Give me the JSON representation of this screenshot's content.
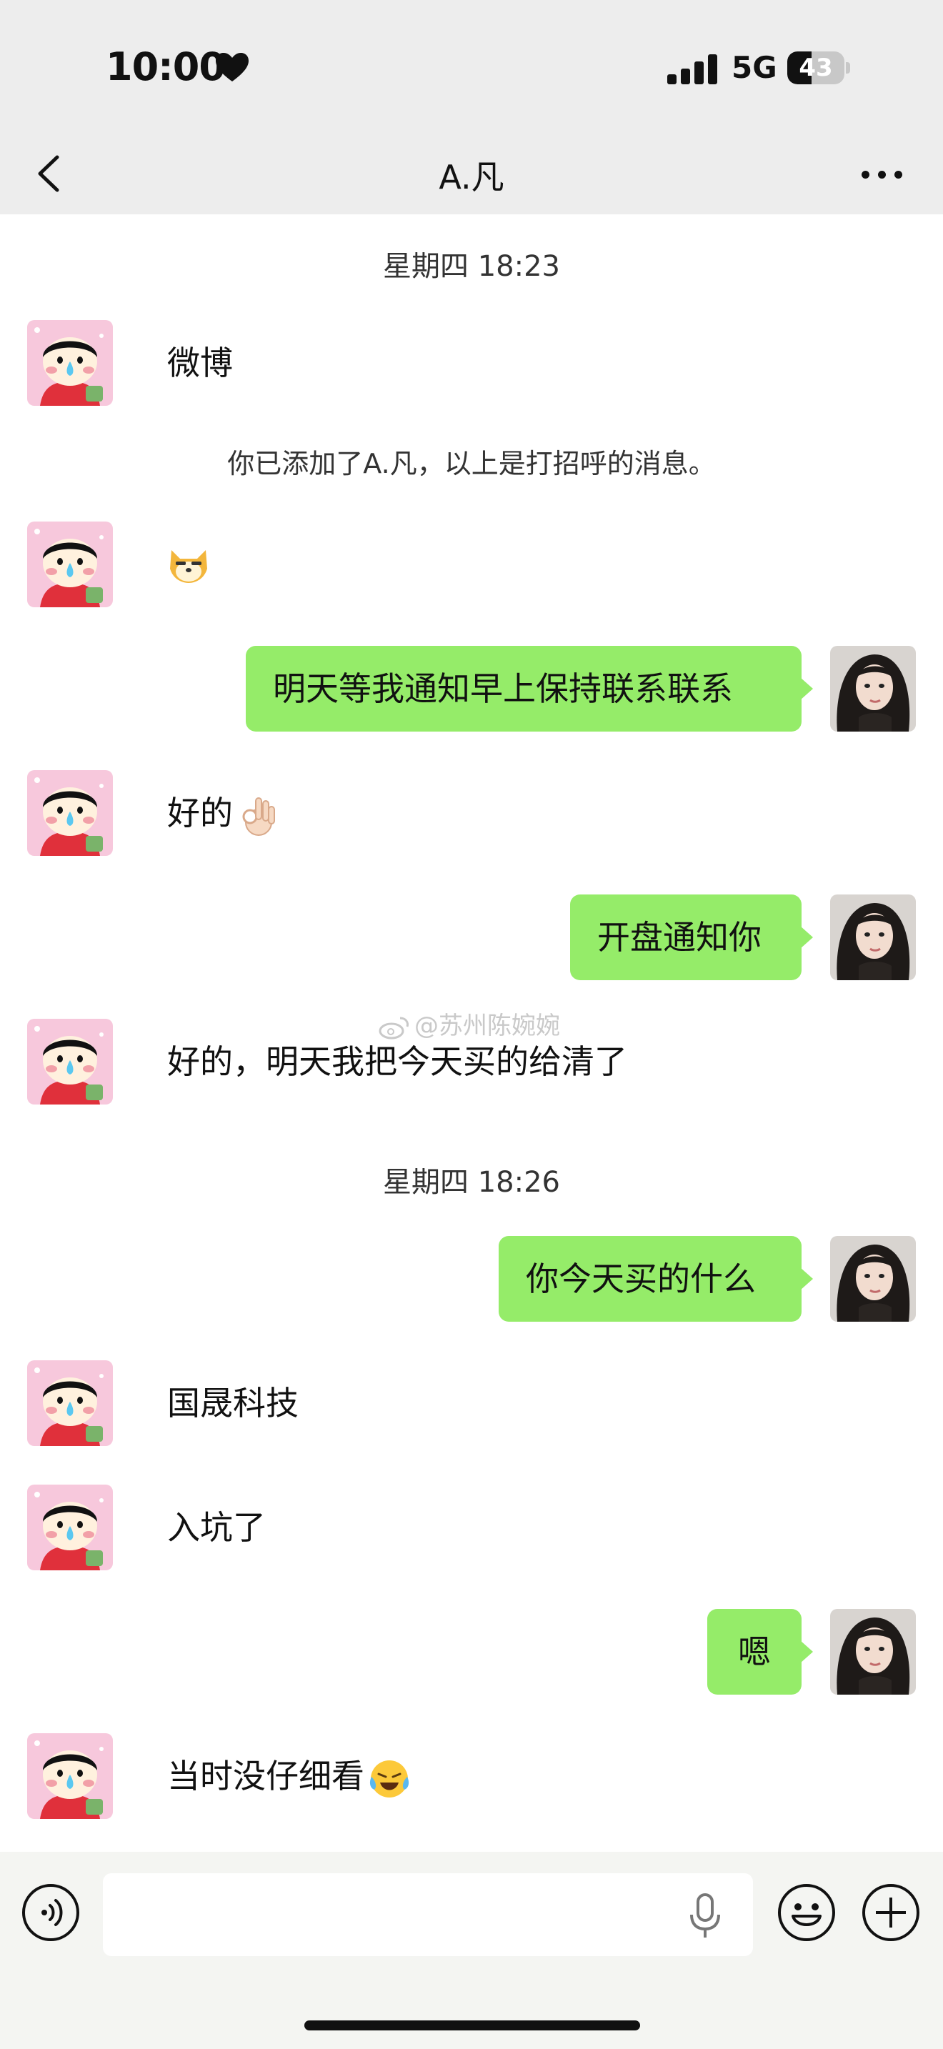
{
  "status": {
    "time": "10:00",
    "network": "5G",
    "battery_level": "43"
  },
  "nav": {
    "title": "A.凡"
  },
  "messages": {
    "t1": "星期四 18:23",
    "m1": "微博",
    "sys1": "你已添加了A.凡，以上是打招呼的消息。",
    "m3": "明天等我通知早上保持联系联系",
    "m4": "好的",
    "m5": "开盘通知你",
    "m6": "好的，明天我把今天买的给清了",
    "t2": "星期四 18:26",
    "m7": "你今天买的什么",
    "m8": "国晟科技",
    "m9": "入坑了",
    "m10": "嗯",
    "m11": "当时没仔细看"
  },
  "watermark": "@苏州陈婉婉",
  "colors": {
    "outgoing_bubble": "#95ec69",
    "background": "#ffffff",
    "bar": "#ededed"
  },
  "icons": [
    "heart-icon",
    "signal-icon",
    "battery-icon",
    "back-icon",
    "more-icon",
    "doge-emoji",
    "ok-hand-emoji",
    "crying-laugh-emoji",
    "voice-icon",
    "mic-icon",
    "emoji-icon",
    "add-icon",
    "weibo-icon"
  ]
}
